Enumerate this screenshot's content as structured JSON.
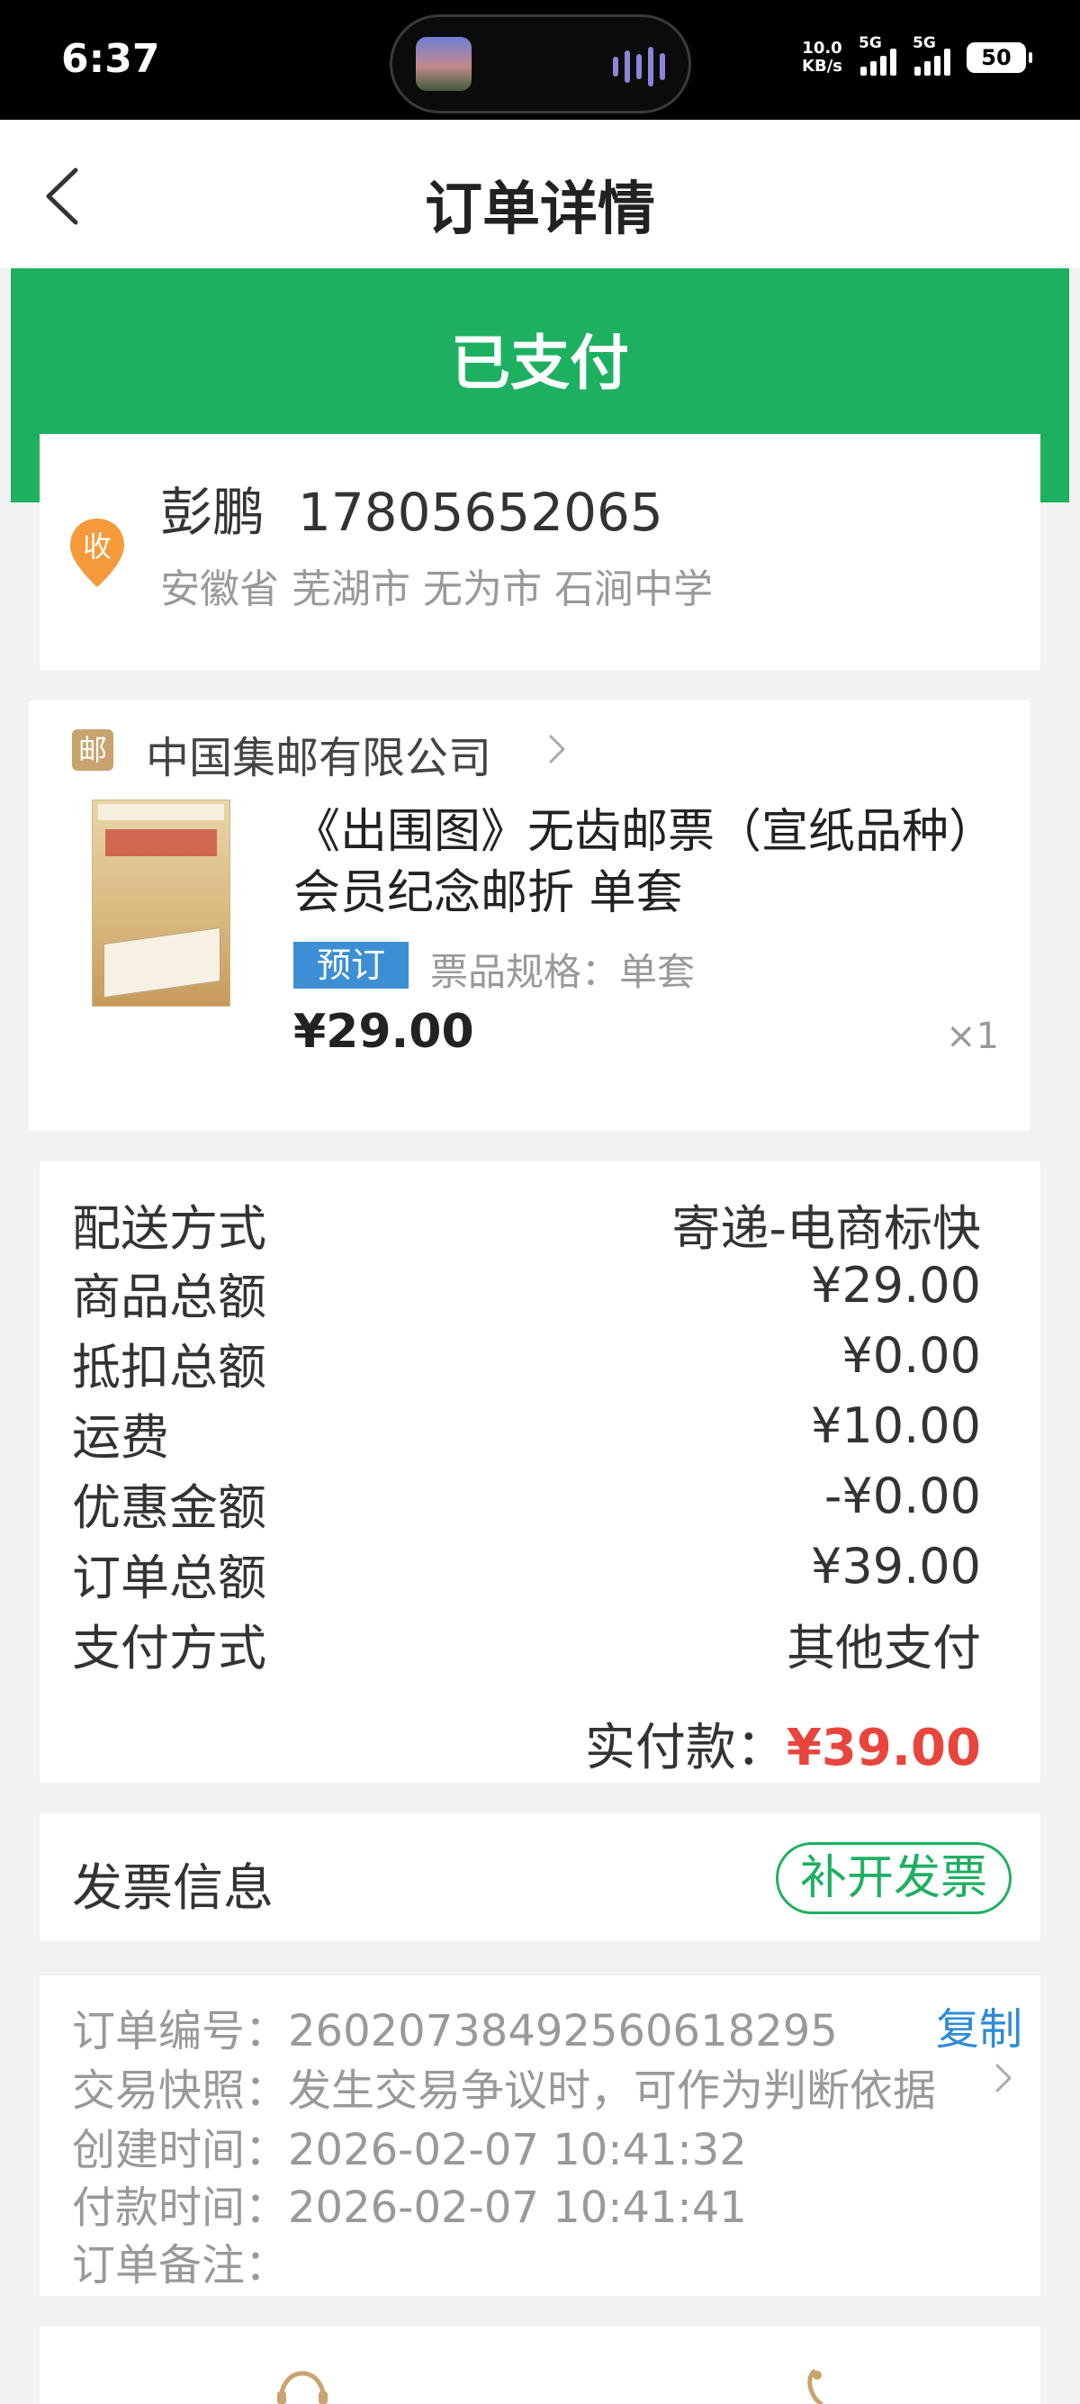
{
  "status_bar": {
    "time": "6:37",
    "net_speed": "10.0",
    "net_unit": "KB/s",
    "sim1": "5G",
    "sim2": "5G",
    "battery": "50"
  },
  "nav": {
    "title": "订单详情",
    "back_icon": "chevron-left-icon"
  },
  "status": {
    "label": "已支付",
    "color": "#1eb061"
  },
  "address": {
    "badge": "收",
    "name_phone": "彭鹏  17805652065",
    "detail": "安徽省 芜湖市 无为市 石涧中学"
  },
  "shop": {
    "badge": "邮",
    "name": "中国集邮有限公司",
    "product": {
      "title": "《出围图》无齿邮票（宣纸品种）会员纪念邮折 单套",
      "tag": "预订",
      "spec": "票品规格：单套",
      "price": "¥29.00",
      "qty": "×1"
    }
  },
  "summary": {
    "rows": [
      {
        "label": "配送方式",
        "value": "寄递-电商标快"
      },
      {
        "label": "商品总额",
        "value": "¥29.00"
      },
      {
        "label": "抵扣总额",
        "value": "¥0.00"
      },
      {
        "label": "运费",
        "value": "¥10.00"
      },
      {
        "label": "优惠金额",
        "value": "-¥0.00"
      },
      {
        "label": "订单总额",
        "value": "¥39.00"
      },
      {
        "label": "支付方式",
        "value": "其他支付"
      }
    ],
    "paid_label": "实付款：",
    "paid_value": "¥39.00"
  },
  "invoice": {
    "title": "发票信息",
    "button": "补开发票"
  },
  "order_info": {
    "order_no": "订单编号：26020738492560618295",
    "copy": "复制",
    "snapshot": "交易快照：发生交易争议时，可作为判断依据",
    "created": "创建时间：2026-02-07 10:41:32",
    "paid_time": "付款时间：2026-02-07 10:41:41",
    "remark": "订单备注："
  },
  "colors": {
    "accent": "#1eb061",
    "price_red": "#e8453c",
    "link_blue": "#2d8bd8"
  }
}
